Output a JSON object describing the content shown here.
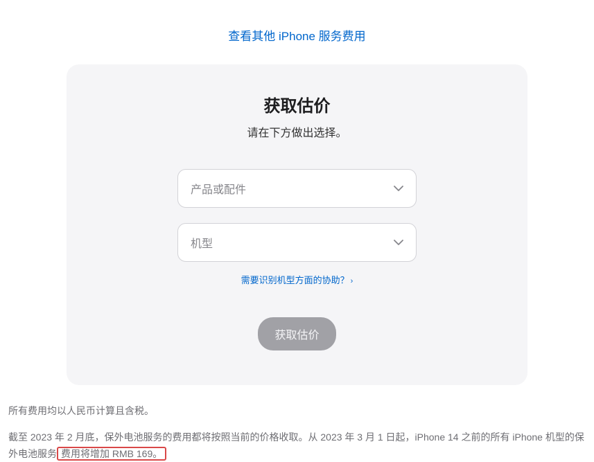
{
  "topLink": {
    "text": "查看其他 iPhone 服务费用"
  },
  "card": {
    "title": "获取估价",
    "subtitle": "请在下方做出选择。",
    "select1": {
      "placeholder": "产品或配件"
    },
    "select2": {
      "placeholder": "机型"
    },
    "helpLink": {
      "text": "需要识别机型方面的协助？"
    },
    "submitButton": {
      "label": "获取估价"
    }
  },
  "footer": {
    "line1": "所有费用均以人民币计算且含税。",
    "line2_part1": "截至 2023 年 2 月底，保外电池服务的费用都将按照当前的价格收取。从 2023 年 3 月 1 日起，iPhone 14 之前的所有 iPhone 机型的保外电池服务",
    "line2_highlight": "费用将增加 RMB 169。"
  }
}
